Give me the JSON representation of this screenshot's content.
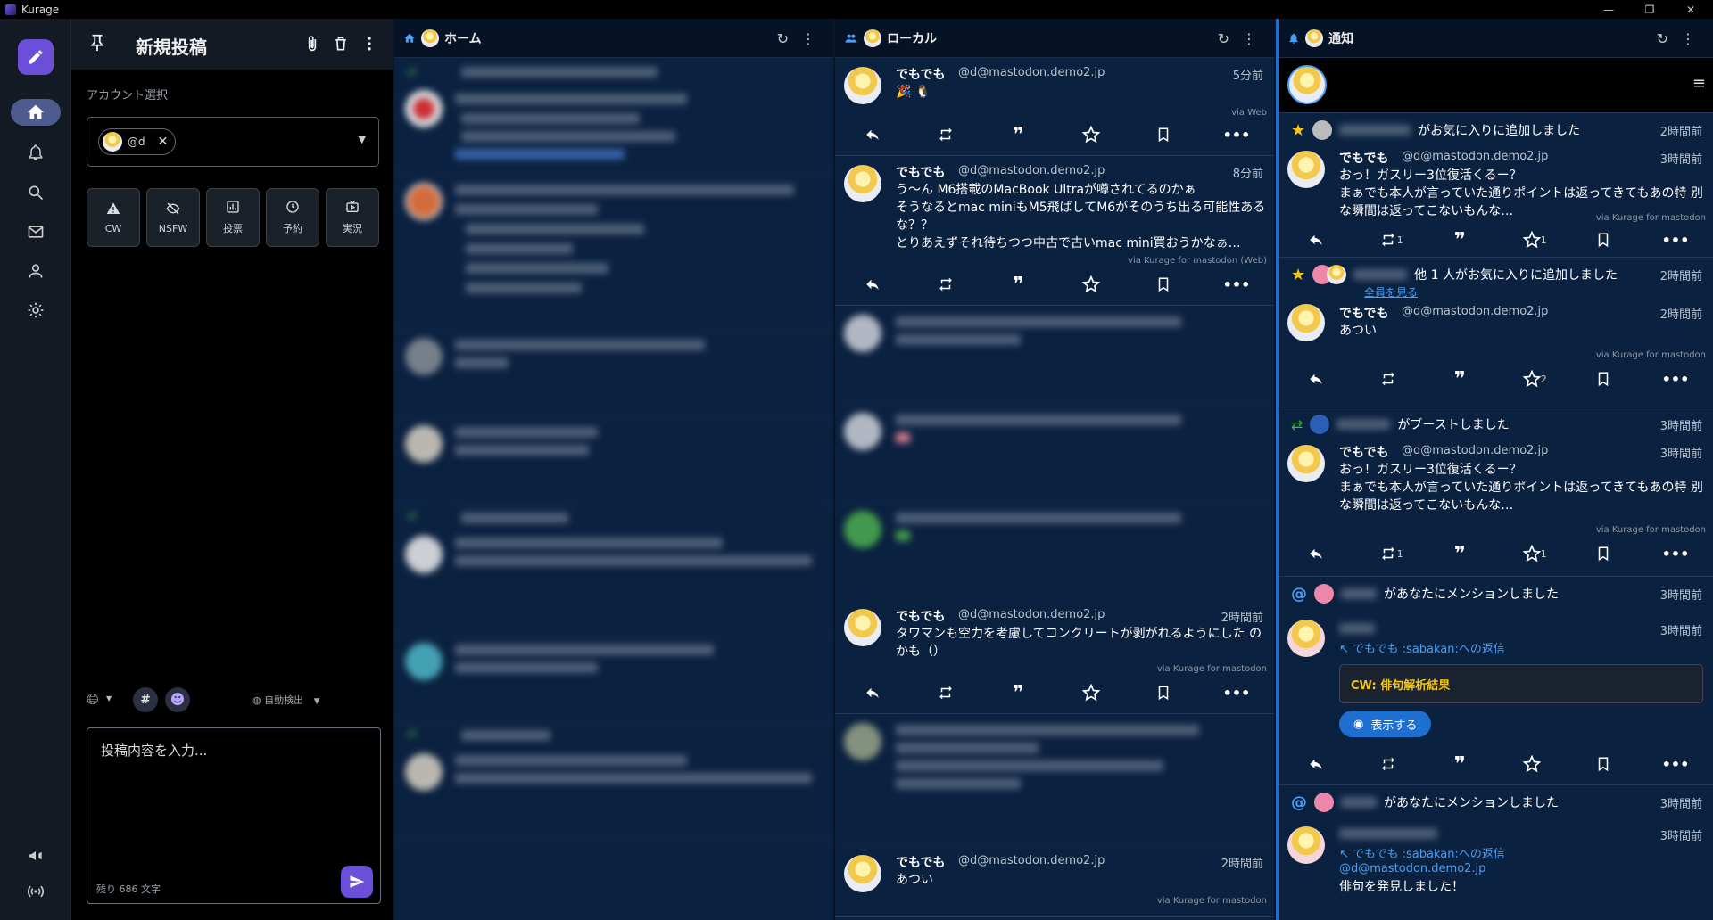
{
  "app": {
    "title": "Kurage"
  },
  "window_controls": {
    "minimize": "—",
    "restore": "❐",
    "close": "✕"
  },
  "compose": {
    "title": "新規投稿",
    "account_label": "アカウント選択",
    "chip_handle": "@d",
    "options": [
      {
        "icon": "warning-icon",
        "label": "CW"
      },
      {
        "icon": "eye-off-icon",
        "label": "NSFW"
      },
      {
        "icon": "poll-icon",
        "label": "投票"
      },
      {
        "icon": "clock-icon",
        "label": "予約"
      },
      {
        "icon": "live-icon",
        "label": "実況"
      }
    ],
    "visibility_icon": "globe-icon",
    "language": "自動検出",
    "placeholder": "投稿内容を入力...",
    "remaining": "残り 686 文字"
  },
  "columns": {
    "home": {
      "title": "ホーム"
    },
    "local": {
      "title": "ローカル"
    },
    "notifications": {
      "title": "通知"
    }
  },
  "local_posts": [
    {
      "name": "でもでも",
      "acct": "@d@mastodon.demo2.jp",
      "time": "5分前",
      "body": "🎉 🐧",
      "via": "via Web"
    },
    {
      "name": "でもでも",
      "acct": "@d@mastodon.demo2.jp",
      "time": "8分前",
      "body": "う〜ん M6搭載のMacBook Ultraが噂されてるのかぁ\nそうなるとmac miniもM5飛ばしてM6がそのうち出る可能性ある な？？\nとりあえずそれ待ちつつ中古で古いmac mini買おうかなぁ…",
      "via": "via Kurage for mastodon (Web)"
    },
    {
      "name": "でもでも",
      "acct": "@d@mastodon.demo2.jp",
      "time": "2時間前",
      "body": "タワマンも空力を考慮してコンクリートが剥がれるようにした のかも（）",
      "via": "via Kurage for mastodon"
    },
    {
      "name": "でもでも",
      "acct": "@d@mastodon.demo2.jp",
      "time": "2時間前",
      "body": "あつい",
      "via": "via Kurage for mastodon"
    }
  ],
  "notifications": [
    {
      "type": "favourite",
      "text": "がお気に入りに追加しました",
      "time": "2時間前",
      "post": {
        "name": "でもでも",
        "acct": "@d@mastodon.demo2.jp",
        "time": "3時間前",
        "body": "おっ！ガスリー3位復活くるー？\nまぁでも本人が言っていた通りポイントは返ってきてもあの特 別な瞬間は返ってこないもんな…",
        "via": "via Kurage for mastodon",
        "boosts": "1",
        "favs": "1"
      }
    },
    {
      "type": "favourite",
      "text": "他 1 人がお気に入りに追加しました",
      "link": "全員を見る",
      "time": "2時間前",
      "post": {
        "name": "でもでも",
        "acct": "@d@mastodon.demo2.jp",
        "time": "2時間前",
        "body": "あつい",
        "via": "via Kurage for mastodon",
        "boosts": "",
        "favs": "2"
      }
    },
    {
      "type": "boost",
      "text": "がブーストしました",
      "time": "3時間前",
      "post": {
        "name": "でもでも",
        "acct": "@d@mastodon.demo2.jp",
        "time": "3時間前",
        "body": "おっ！ガスリー3位復活くるー？\nまぁでも本人が言っていた通りポイントは返ってきてもあの特 別な瞬間は返ってこないもんな…",
        "via": "via Kurage for mastodon",
        "boosts": "1",
        "favs": "1"
      }
    },
    {
      "type": "mention",
      "text": "があなたにメンションしました",
      "time": "3時間前",
      "post": {
        "time": "3時間前",
        "reply": "でもでも :sabakan:への返信",
        "cw": "CW: 俳句解析結果",
        "show": "表示する"
      }
    },
    {
      "type": "mention",
      "text": "があなたにメンションしました",
      "time": "3時間前",
      "post": {
        "time": "3時間前",
        "reply": "でもでも :sabakan:への返信",
        "mention": "@d@mastodon.demo2.jp",
        "body": "俳句を発見しました！"
      }
    }
  ],
  "colors": {
    "accent": "#6b4fd8",
    "column_bg": "#0b2140",
    "star": "#f5c518",
    "boost": "#4caf50",
    "link": "#4a9ff5"
  }
}
